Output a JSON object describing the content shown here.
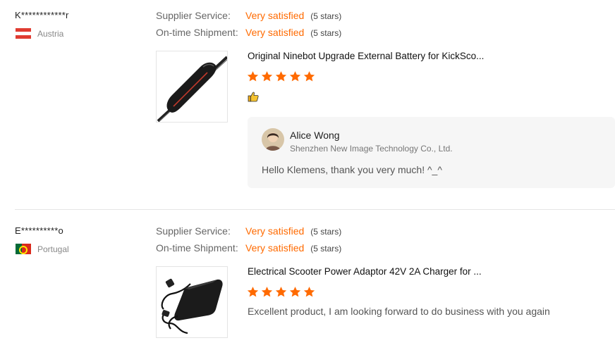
{
  "reviews": [
    {
      "buyer": "K************r",
      "country": "Austria",
      "ratings": [
        {
          "label": "Supplier Service:",
          "value": "Very satisfied",
          "stars_text": "(5 stars)"
        },
        {
          "label": "On-time Shipment:",
          "value": "Very satisfied",
          "stars_text": "(5 stars)"
        }
      ],
      "product": {
        "title": "Original Ninebot Upgrade External Battery for KickSco...",
        "image": "scooter-battery-image"
      },
      "stars": 5,
      "icon": "thumbs-up-icon",
      "reply": {
        "name": "Alice Wong",
        "company": "Shenzhen New Image Technology Co., Ltd.",
        "text": "Hello Klemens, thank you very much! ^_^"
      }
    },
    {
      "buyer": "E**********o",
      "country": "Portugal",
      "ratings": [
        {
          "label": "Supplier Service:",
          "value": "Very satisfied",
          "stars_text": "(5 stars)"
        },
        {
          "label": "On-time Shipment:",
          "value": "Very satisfied",
          "stars_text": "(5 stars)"
        }
      ],
      "product": {
        "title": "Electrical Scooter Power Adaptor 42V 2A Charger for ...",
        "image": "power-adaptor-image"
      },
      "stars": 5,
      "text": "Excellent product, I am looking forward to do business with you again"
    }
  ],
  "colors": {
    "accent": "#ff6a00",
    "star": "#ff6a00",
    "divider": "#e6e6e6",
    "reply_bg": "#f6f6f6"
  }
}
